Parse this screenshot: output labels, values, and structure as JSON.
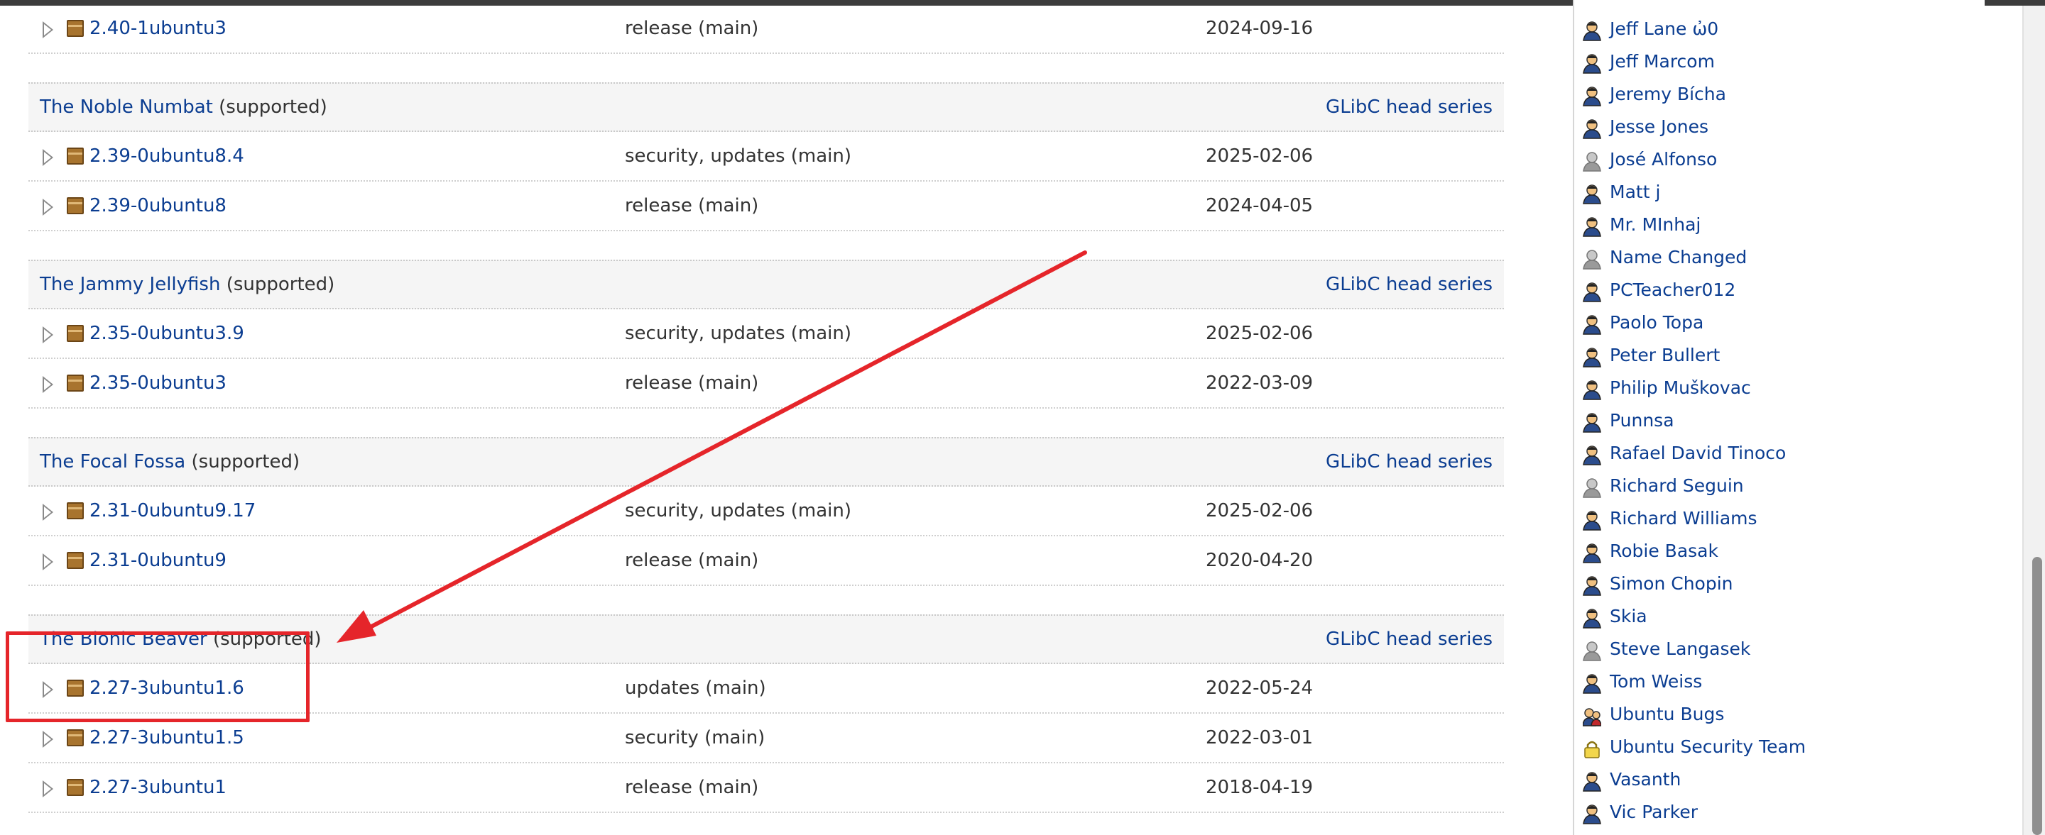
{
  "series": [
    {
      "name": "",
      "status": "",
      "head_link": "",
      "packages": [
        {
          "version": "2.40-1ubuntu3",
          "pocket": "release (main)",
          "date": "2024-09-16"
        }
      ]
    },
    {
      "name": "The Noble Numbat",
      "status": "(supported)",
      "head_link": "GLibC head series",
      "packages": [
        {
          "version": "2.39-0ubuntu8.4",
          "pocket": "security, updates (main)",
          "date": "2025-02-06"
        },
        {
          "version": "2.39-0ubuntu8",
          "pocket": "release (main)",
          "date": "2024-04-05"
        }
      ]
    },
    {
      "name": "The Jammy Jellyfish",
      "status": "(supported)",
      "head_link": "GLibC head series",
      "packages": [
        {
          "version": "2.35-0ubuntu3.9",
          "pocket": "security, updates (main)",
          "date": "2025-02-06"
        },
        {
          "version": "2.35-0ubuntu3",
          "pocket": "release (main)",
          "date": "2022-03-09"
        }
      ]
    },
    {
      "name": "The Focal Fossa",
      "status": "(supported)",
      "head_link": "GLibC head series",
      "packages": [
        {
          "version": "2.31-0ubuntu9.17",
          "pocket": "security, updates (main)",
          "date": "2025-02-06"
        },
        {
          "version": "2.31-0ubuntu9",
          "pocket": "release (main)",
          "date": "2020-04-20"
        }
      ]
    },
    {
      "name": "The Bionic Beaver",
      "status": "(supported)",
      "head_link": "GLibC head series",
      "packages": [
        {
          "version": "2.27-3ubuntu1.6",
          "pocket": "updates (main)",
          "date": "2022-05-24"
        },
        {
          "version": "2.27-3ubuntu1.5",
          "pocket": "security (main)",
          "date": "2022-03-01"
        },
        {
          "version": "2.27-3ubuntu1",
          "pocket": "release (main)",
          "date": "2018-04-19"
        }
      ]
    }
  ],
  "subscribers": [
    {
      "name": "Jeff Lane ὠ0",
      "avatar": "person"
    },
    {
      "name": "Jeff Marcom",
      "avatar": "person"
    },
    {
      "name": "Jeremy Bícha",
      "avatar": "person"
    },
    {
      "name": "Jesse Jones",
      "avatar": "person"
    },
    {
      "name": "José Alfonso",
      "avatar": "person-inactive"
    },
    {
      "name": "Matt j",
      "avatar": "person"
    },
    {
      "name": "Mr. MInhaj",
      "avatar": "person"
    },
    {
      "name": "Name Changed",
      "avatar": "person-inactive"
    },
    {
      "name": "PCTeacher012",
      "avatar": "person"
    },
    {
      "name": "Paolo Topa",
      "avatar": "person"
    },
    {
      "name": "Peter Bullert",
      "avatar": "person"
    },
    {
      "name": "Philip Muškovac",
      "avatar": "person"
    },
    {
      "name": "Punnsa",
      "avatar": "person"
    },
    {
      "name": "Rafael David Tinoco",
      "avatar": "person"
    },
    {
      "name": "Richard Seguin",
      "avatar": "person-inactive"
    },
    {
      "name": "Richard Williams",
      "avatar": "person"
    },
    {
      "name": "Robie Basak",
      "avatar": "person"
    },
    {
      "name": "Simon Chopin",
      "avatar": "person"
    },
    {
      "name": "Skia",
      "avatar": "person"
    },
    {
      "name": "Steve Langasek",
      "avatar": "person-inactive"
    },
    {
      "name": "Tom Weiss",
      "avatar": "person"
    },
    {
      "name": "Ubuntu Bugs",
      "avatar": "team"
    },
    {
      "name": "Ubuntu Security Team",
      "avatar": "private-team"
    },
    {
      "name": "Vasanth",
      "avatar": "person"
    },
    {
      "name": "Vic Parker",
      "avatar": "person"
    }
  ],
  "colors": {
    "link": "#0b3d91",
    "highlight": "#e5252a",
    "header_bg": "#f5f5f5"
  }
}
